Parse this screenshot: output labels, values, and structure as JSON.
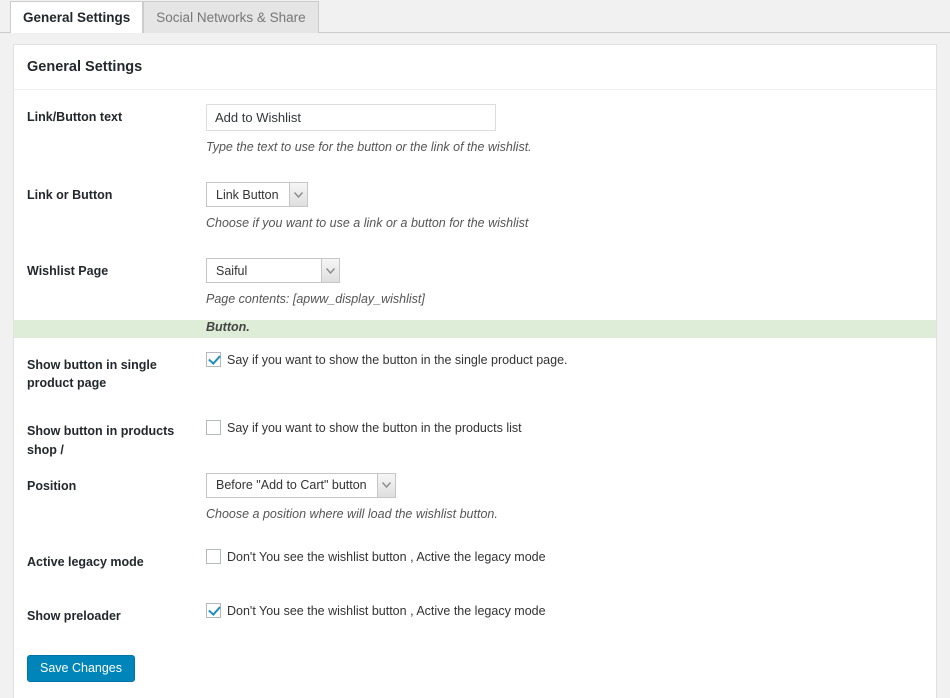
{
  "tabs": [
    {
      "label": "General Settings",
      "active": true
    },
    {
      "label": "Social Networks & Share",
      "active": false
    }
  ],
  "panel": {
    "title": "General Settings"
  },
  "fields": {
    "link_button_text": {
      "label": "Link/Button text",
      "value": "Add to Wishlist",
      "placeholder": "",
      "description": "Type the text to use for the button or the link of the wishlist."
    },
    "link_or_button": {
      "label": "Link or Button",
      "value": "Link Button",
      "description": "Choose if you want to use a link or a button for the wishlist"
    },
    "wishlist_page": {
      "label": "Wishlist Page",
      "value": "Saiful",
      "description": "Page contents: [apww_display_wishlist]"
    },
    "section_button": {
      "label": "Button."
    },
    "show_single_product": {
      "label": "Show button in single product page",
      "checkbox_label": "Say if you want to show the button in the single product page.",
      "checked": true
    },
    "show_products_shop": {
      "label": "Show button in products shop /",
      "checkbox_label": "Say if you want to show the button in the products list",
      "checked": false
    },
    "position": {
      "label": "Position",
      "value": "Before \"Add to Cart\" button",
      "description": "Choose a position where will load the wishlist button."
    },
    "active_legacy_mode": {
      "label": "Active legacy mode",
      "checkbox_label": "Don't You see the wishlist button , Active the legacy mode",
      "checked": false
    },
    "show_preloader": {
      "label": "Show preloader",
      "checkbox_label": "Don't You see the wishlist button , Active the legacy mode",
      "checked": true
    }
  },
  "submit": {
    "label": "Save Changes"
  },
  "colors": {
    "accent": "#0085ba",
    "section_band": "#deedd8",
    "checkmark": "#1e8cbe",
    "page_background": "#f1f1f1"
  },
  "icons": {
    "dropdown": "chevron-down-icon",
    "checkbox_check": "check-icon"
  }
}
